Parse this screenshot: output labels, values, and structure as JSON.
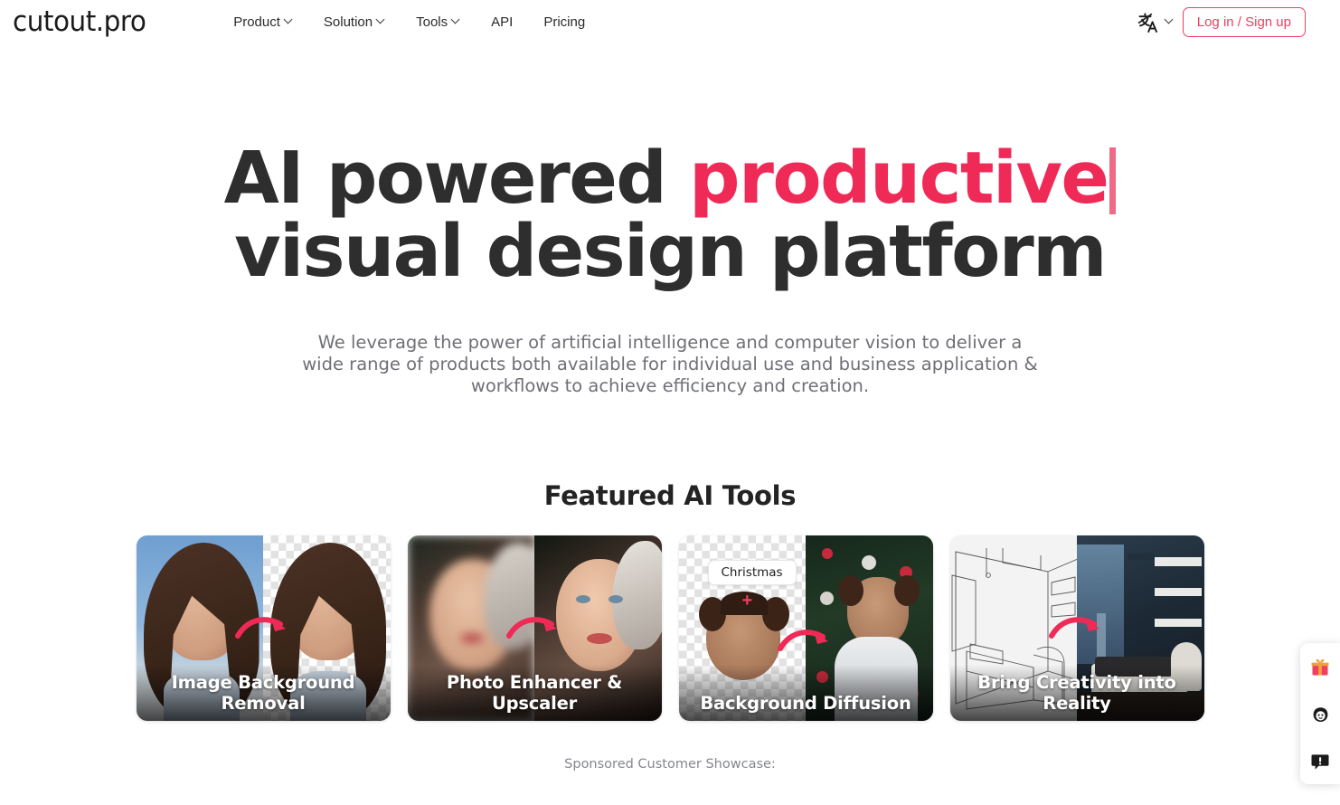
{
  "header": {
    "logo_text": "cutout.pro",
    "nav": [
      {
        "label": "Product",
        "has_dropdown": true,
        "icon": "chevron-down-icon"
      },
      {
        "label": "Solution",
        "has_dropdown": true,
        "icon": "chevron-down-icon"
      },
      {
        "label": "Tools",
        "has_dropdown": true,
        "icon": "chevron-down-icon"
      },
      {
        "label": "API",
        "has_dropdown": false,
        "icon": ""
      },
      {
        "label": "Pricing",
        "has_dropdown": false,
        "icon": ""
      }
    ],
    "language": {
      "icon": "translate-icon",
      "dropdown_icon": "chevron-down-icon"
    },
    "login_button": "Log in / Sign up"
  },
  "hero": {
    "headline_part1": "AI powered ",
    "headline_accent": "productive",
    "headline_line2": "visual design platform",
    "caret_visible": true,
    "subtitle": "We leverage the power of artificial intelligence and computer vision to deliver a wide range of products both available for individual use and business application & workflows to achieve efficiency and creation."
  },
  "featured": {
    "title": "Featured AI Tools",
    "cards": [
      {
        "label": "Image Background Removal",
        "badge": "",
        "plus": ""
      },
      {
        "label": "Photo Enhancer & Upscaler",
        "badge": "",
        "plus": ""
      },
      {
        "label": "Background Diffusion",
        "badge": "Christmas",
        "plus": "+"
      },
      {
        "label": "Bring Creativity into Reality",
        "badge": "",
        "plus": ""
      }
    ]
  },
  "sponsored": {
    "label": "Sponsored Customer Showcase:"
  },
  "widget": {
    "buttons": [
      {
        "icon": "gift-icon"
      },
      {
        "icon": "face-avatar-icon"
      },
      {
        "icon": "feedback-alert-icon"
      }
    ]
  },
  "colors": {
    "accent_pink": "#ef2a57",
    "accent_button": "#ef3e62",
    "heading_dark": "#2e2e2e",
    "body_gray": "#6f7076",
    "caret_pink": "#f06a86"
  }
}
